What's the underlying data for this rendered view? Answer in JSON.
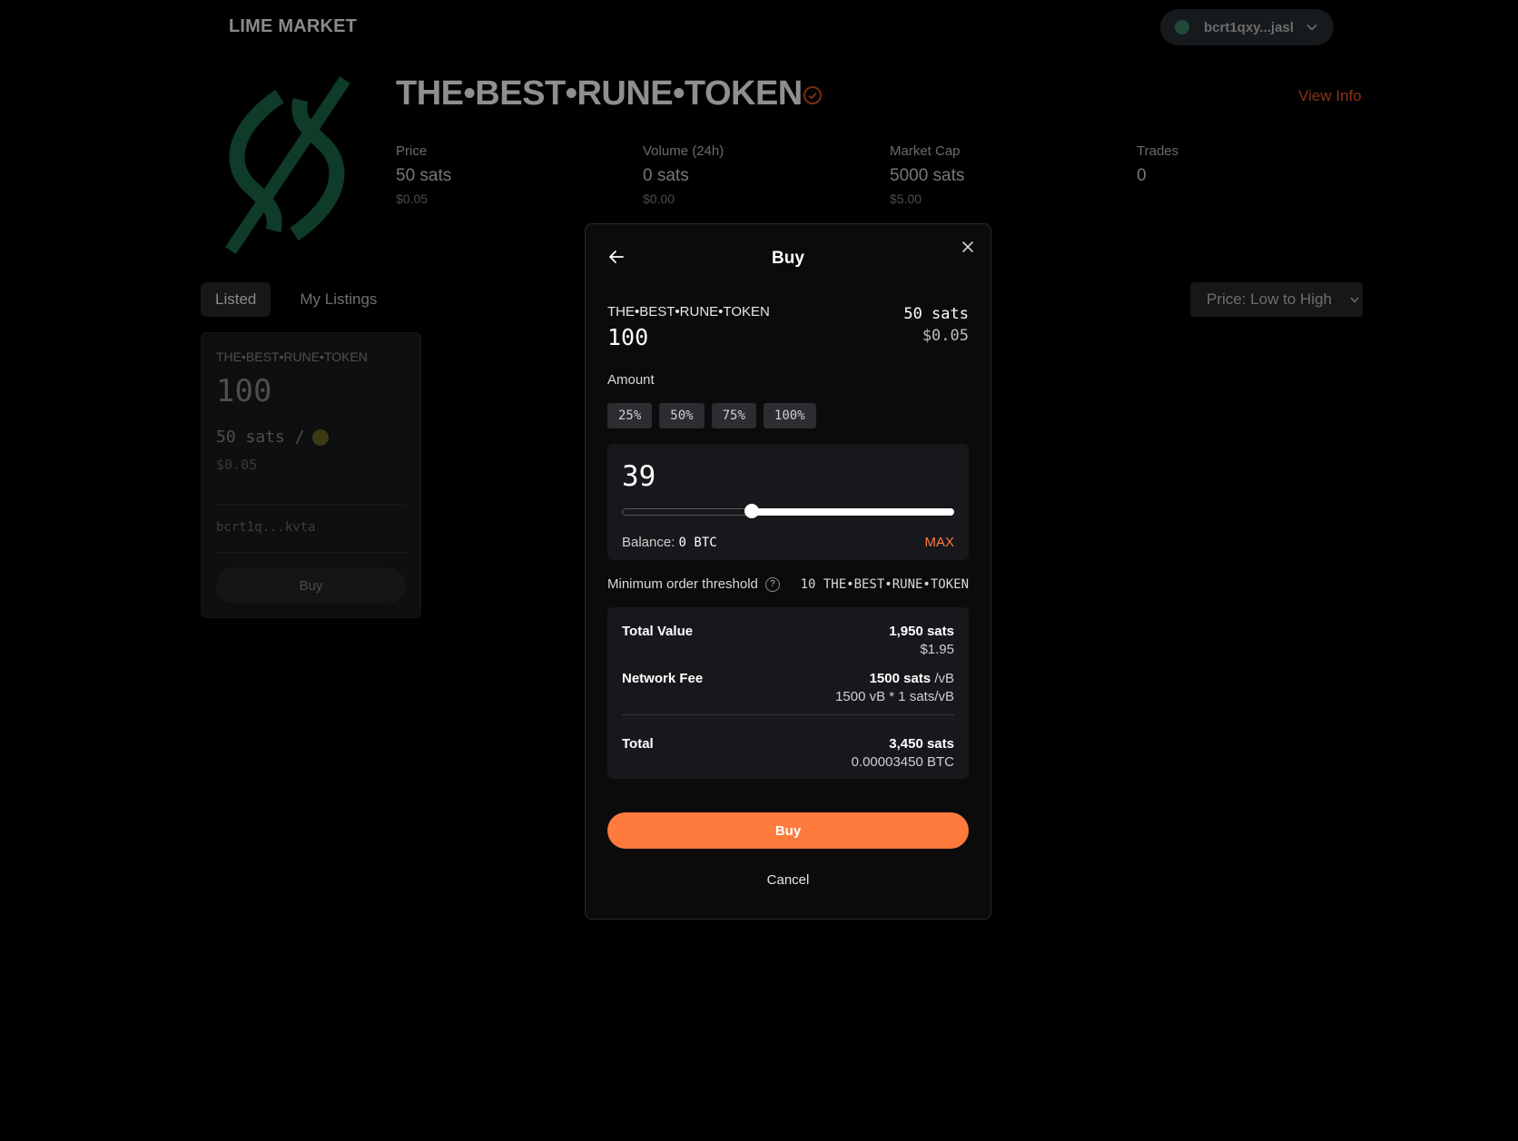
{
  "app": {
    "logo": "LIME MARKET"
  },
  "wallet": {
    "address": "bcrt1qxy...jasl"
  },
  "token": {
    "title": "THE•BEST•RUNE•TOKEN",
    "view_info": "View Info",
    "stats": [
      {
        "label": "Price",
        "value": "50 sats",
        "usd": "$0.05"
      },
      {
        "label": "Volume (24h)",
        "value": "0 sats",
        "usd": "$0.00"
      },
      {
        "label": "Market Cap",
        "value": "5000 sats",
        "usd": "$5.00"
      },
      {
        "label": "Trades",
        "value": "0",
        "usd": ""
      }
    ]
  },
  "tabs": [
    {
      "label": "Listed",
      "active": true
    },
    {
      "label": "My Listings",
      "active": false
    }
  ],
  "sort": {
    "selected": "Price: Low to High"
  },
  "listing": {
    "name": "THE•BEST•RUNE•TOKEN",
    "amount": "100",
    "price": "50 sats /",
    "usd": "$0.05",
    "seller": "bcrt1q...kvta",
    "buy_label": "Buy"
  },
  "modal": {
    "title": "Buy",
    "rune_name": "THE•BEST•RUNE•TOKEN",
    "rune_amount": "100",
    "price": "50 sats",
    "price_usd": "$0.05",
    "amount_label": "Amount",
    "percent_buttons": [
      "25%",
      "50%",
      "75%",
      "100%"
    ],
    "amount_value": "39",
    "slider": {
      "min": 0,
      "max": 100,
      "value": 39
    },
    "balance_label": "Balance:",
    "balance_value": "0 BTC",
    "max_label": "MAX",
    "threshold_label": "Minimum order threshold",
    "threshold_help": "?",
    "threshold_value": "10 THE•BEST•RUNE•TOKEN",
    "summary": {
      "total_value": {
        "label": "Total Value",
        "main": "1,950 sats",
        "sub": "$1.95"
      },
      "network_fee": {
        "label": "Network Fee",
        "main": "1500 sats",
        "unit": " /vB",
        "sub": "1500 vB * 1 sats/vB"
      },
      "total": {
        "label": "Total",
        "main": "3,450 sats",
        "sub": "0.00003450 BTC"
      }
    },
    "buy_label": "Buy",
    "cancel_label": "Cancel"
  },
  "colors": {
    "accent": "#ff7a3d",
    "background": "#000000",
    "panel": "#17181b",
    "brand_green": "#0f3b29"
  }
}
